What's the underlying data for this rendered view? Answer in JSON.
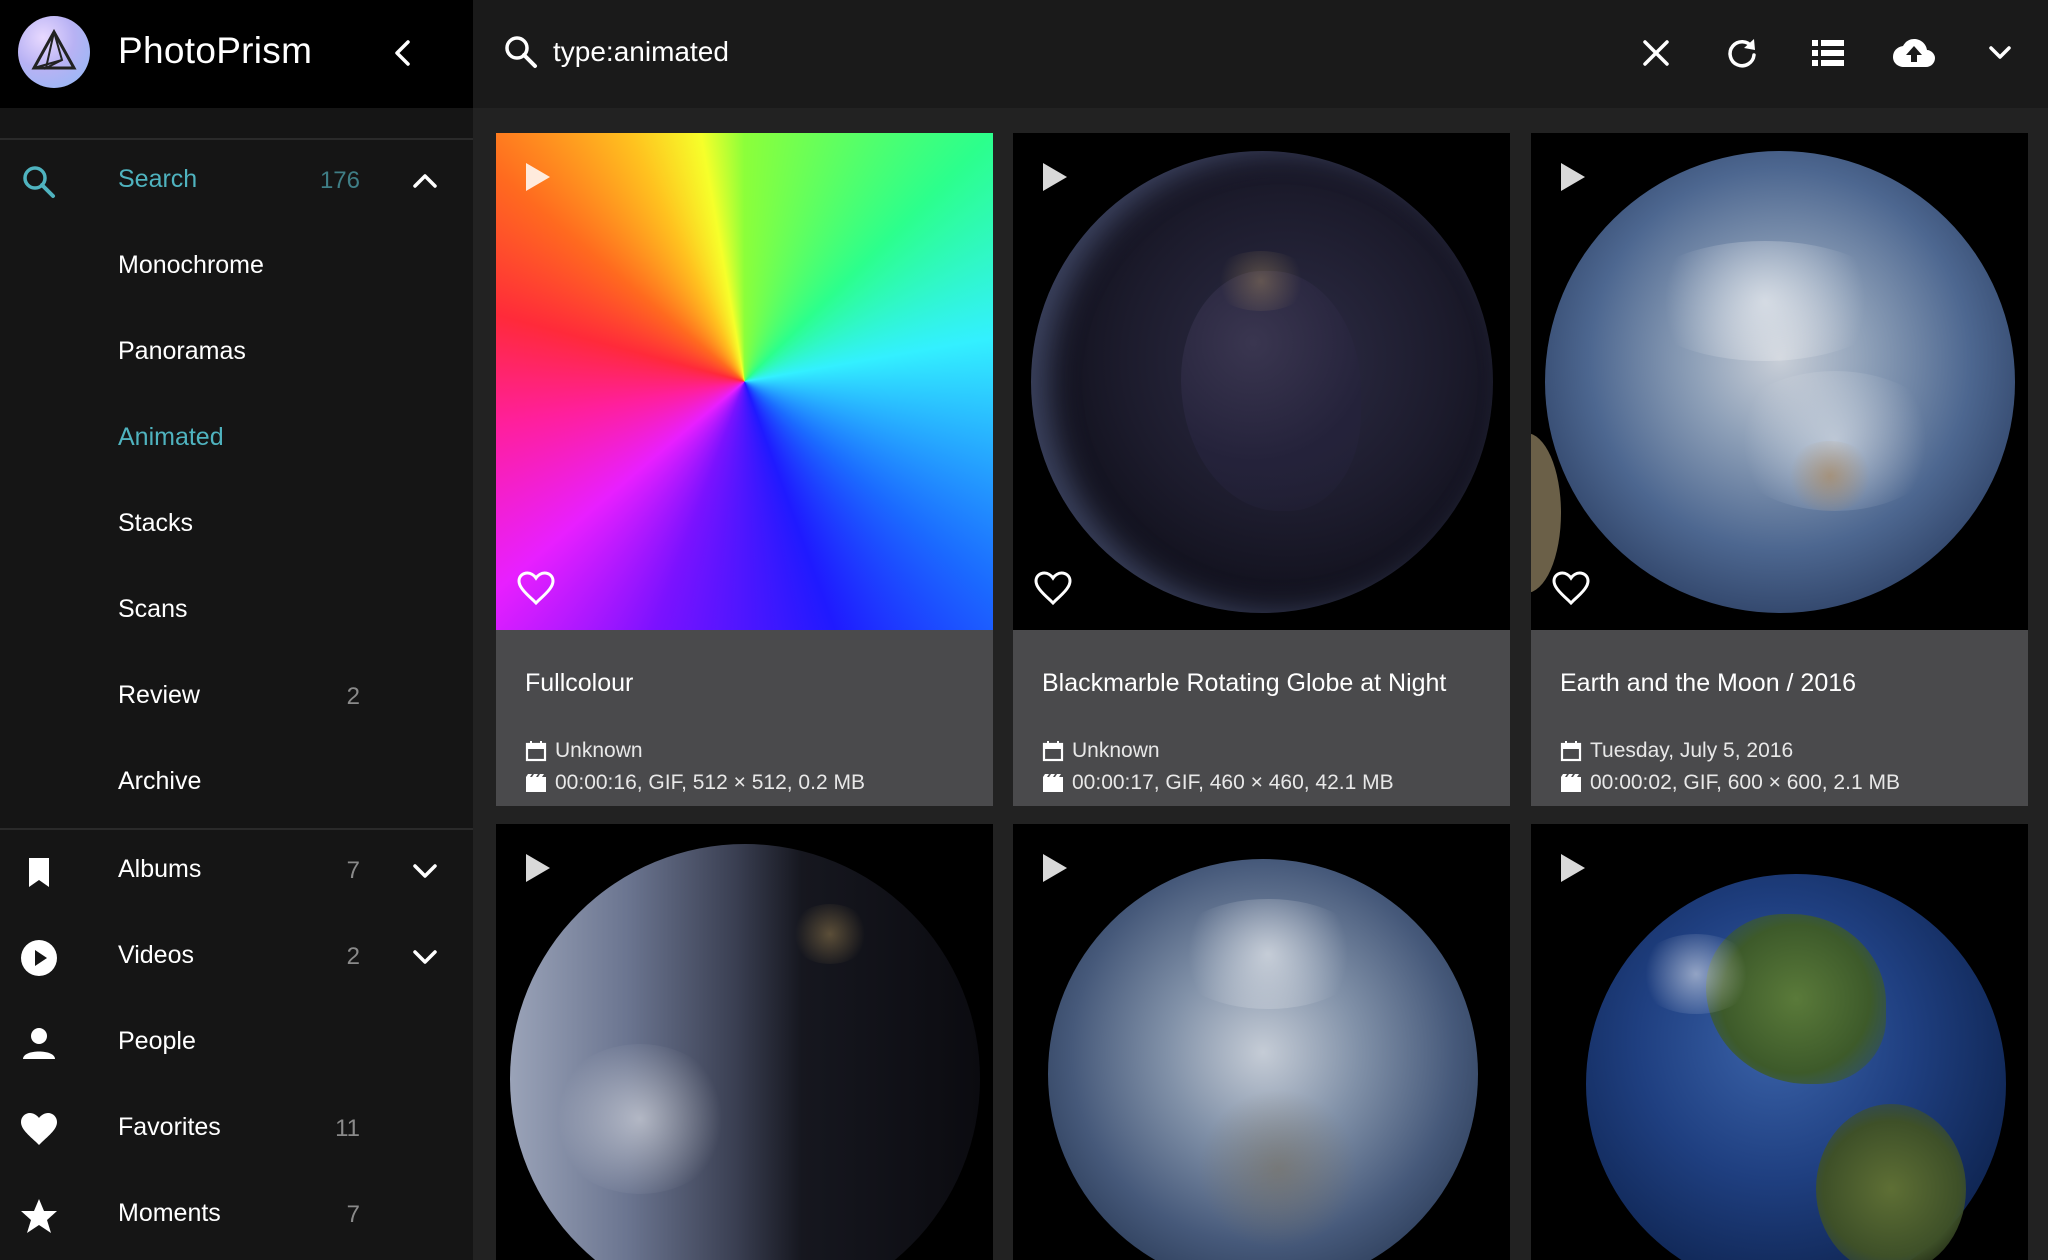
{
  "app": {
    "title": "PhotoPrism"
  },
  "search": {
    "query": "type:animated"
  },
  "sidebar": {
    "search": {
      "label": "Search",
      "count": "176"
    },
    "subitems": [
      {
        "label": "Monochrome"
      },
      {
        "label": "Panoramas"
      },
      {
        "label": "Animated"
      },
      {
        "label": "Stacks"
      },
      {
        "label": "Scans"
      },
      {
        "label": "Review",
        "count": "2"
      },
      {
        "label": "Archive"
      }
    ],
    "items": [
      {
        "label": "Albums",
        "count": "7",
        "icon": "bookmark-icon"
      },
      {
        "label": "Videos",
        "count": "2",
        "icon": "play-circle-icon"
      },
      {
        "label": "People",
        "count": "",
        "icon": "person-icon"
      },
      {
        "label": "Favorites",
        "count": "11",
        "icon": "heart-icon"
      },
      {
        "label": "Moments",
        "count": "7",
        "icon": "star-icon"
      }
    ]
  },
  "toolbar": {
    "icons": [
      "close-icon",
      "refresh-icon",
      "list-view-icon",
      "upload-icon",
      "chevron-down-icon"
    ]
  },
  "cards": [
    {
      "title": "Fullcolour",
      "date": "Unknown",
      "info": "00:00:16, GIF, 512 × 512, 0.2 MB"
    },
    {
      "title": "Blackmarble Rotating Globe at Night",
      "date": "Unknown",
      "info": "00:00:17, GIF, 460 × 460, 42.1 MB"
    },
    {
      "title": "Earth and the Moon / 2016",
      "date": "Tuesday, July 5, 2016",
      "info": "00:00:02, GIF, 600 × 600, 2.1 MB"
    },
    {
      "title": "",
      "date": "",
      "info": ""
    },
    {
      "title": "",
      "date": "",
      "info": ""
    },
    {
      "title": "",
      "date": "",
      "info": ""
    }
  ],
  "colors": {
    "accent": "#4fb3bf",
    "card": "#4a4a4c",
    "sidebar": "#151515"
  }
}
